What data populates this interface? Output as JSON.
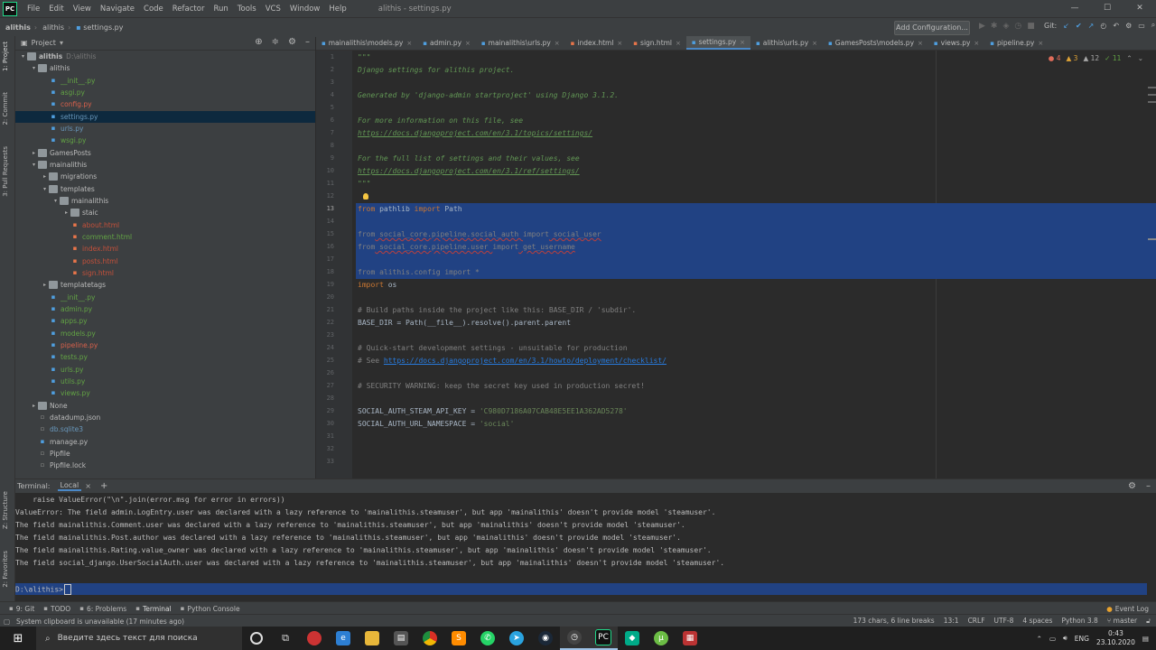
{
  "app": {
    "logo": "PC",
    "window_title": "alithis - settings.py"
  },
  "menu": [
    "File",
    "Edit",
    "View",
    "Navigate",
    "Code",
    "Refactor",
    "Run",
    "Tools",
    "VCS",
    "Window",
    "Help"
  ],
  "window_controls": [
    "—",
    "☐",
    "✕"
  ],
  "breadcrumb": [
    "alithis",
    "alithis",
    "settings.py"
  ],
  "toolbar": {
    "add_config": "Add Configuration...",
    "git_label": "Git:"
  },
  "left_stripe": [
    "1: Project",
    "2: Commit",
    "3: Pull Requests"
  ],
  "left_stripe_bottom": [
    "Z: Structure",
    "2: Favorites"
  ],
  "project_panel": {
    "title": "Project",
    "tree": [
      {
        "name": "alithis",
        "tail": "D:\\alithis",
        "type": "folder",
        "depth": 0,
        "open": true,
        "cls": "",
        "bold": true
      },
      {
        "name": "alithis",
        "type": "folder",
        "depth": 1,
        "open": true,
        "cls": ""
      },
      {
        "name": "__init__.py",
        "type": "py",
        "depth": 2,
        "cls": "py"
      },
      {
        "name": "asgi.py",
        "type": "py",
        "depth": 2,
        "cls": "py"
      },
      {
        "name": "config.py",
        "type": "py",
        "depth": 2,
        "cls": "err"
      },
      {
        "name": "settings.py",
        "type": "py",
        "depth": 2,
        "cls": "mod",
        "selected": true
      },
      {
        "name": "urls.py",
        "type": "py",
        "depth": 2,
        "cls": "mod"
      },
      {
        "name": "wsgi.py",
        "type": "py",
        "depth": 2,
        "cls": "py"
      },
      {
        "name": "GamesPosts",
        "type": "folder",
        "depth": 1,
        "open": false,
        "cls": ""
      },
      {
        "name": "mainalithis",
        "type": "folder",
        "depth": 1,
        "open": true,
        "cls": ""
      },
      {
        "name": "migrations",
        "type": "folder",
        "depth": 2,
        "open": false,
        "cls": ""
      },
      {
        "name": "templates",
        "type": "folder",
        "depth": 2,
        "open": true,
        "cls": ""
      },
      {
        "name": "mainalithis",
        "type": "folder",
        "depth": 3,
        "open": true,
        "cls": ""
      },
      {
        "name": "staic",
        "type": "folder",
        "depth": 4,
        "open": false,
        "cls": ""
      },
      {
        "name": "about.html",
        "type": "html",
        "depth": 4,
        "cls": "html"
      },
      {
        "name": "comment.html",
        "type": "html",
        "depth": 4,
        "cls": "hgreen"
      },
      {
        "name": "index.html",
        "type": "html",
        "depth": 4,
        "cls": "html"
      },
      {
        "name": "posts.html",
        "type": "html",
        "depth": 4,
        "cls": "html"
      },
      {
        "name": "sign.html",
        "type": "html",
        "depth": 4,
        "cls": "html"
      },
      {
        "name": "templatetags",
        "type": "folder",
        "depth": 2,
        "open": false,
        "cls": ""
      },
      {
        "name": "__init__.py",
        "type": "py",
        "depth": 2,
        "cls": "py"
      },
      {
        "name": "admin.py",
        "type": "py",
        "depth": 2,
        "cls": "py"
      },
      {
        "name": "apps.py",
        "type": "py",
        "depth": 2,
        "cls": "py"
      },
      {
        "name": "models.py",
        "type": "py",
        "depth": 2,
        "cls": "py"
      },
      {
        "name": "pipeline.py",
        "type": "py",
        "depth": 2,
        "cls": "err"
      },
      {
        "name": "tests.py",
        "type": "py",
        "depth": 2,
        "cls": "py"
      },
      {
        "name": "urls.py",
        "type": "py",
        "depth": 2,
        "cls": "py"
      },
      {
        "name": "utils.py",
        "type": "py",
        "depth": 2,
        "cls": "py"
      },
      {
        "name": "views.py",
        "type": "py",
        "depth": 2,
        "cls": "py"
      },
      {
        "name": "None",
        "type": "folder",
        "depth": 1,
        "open": false,
        "cls": ""
      },
      {
        "name": "datadump.json",
        "type": "gen",
        "depth": 1,
        "cls": ""
      },
      {
        "name": "db.sqlite3",
        "type": "gen",
        "depth": 1,
        "cls": "mod"
      },
      {
        "name": "manage.py",
        "type": "py",
        "depth": 1,
        "cls": ""
      },
      {
        "name": "Pipfile",
        "type": "gen",
        "depth": 1,
        "cls": ""
      },
      {
        "name": "Pipfile.lock",
        "type": "gen",
        "depth": 1,
        "cls": ""
      }
    ]
  },
  "editor_tabs": [
    {
      "label": "mainalithis\\models.py",
      "type": "py"
    },
    {
      "label": "admin.py",
      "type": "py"
    },
    {
      "label": "mainalithis\\urls.py",
      "type": "py"
    },
    {
      "label": "index.html",
      "type": "html"
    },
    {
      "label": "sign.html",
      "type": "html"
    },
    {
      "label": "settings.py",
      "type": "py",
      "active": true
    },
    {
      "label": "alithis\\urls.py",
      "type": "py"
    },
    {
      "label": "GamesPosts\\models.py",
      "type": "py"
    },
    {
      "label": "views.py",
      "type": "py"
    },
    {
      "label": "pipeline.py",
      "type": "py"
    }
  ],
  "inspections": {
    "errors": "4",
    "warnings": "3",
    "weak": "12",
    "ok": "11"
  },
  "editor": {
    "line_numbers": [
      "1",
      "2",
      "3",
      "4",
      "5",
      "6",
      "7",
      "8",
      "9",
      "10",
      "11",
      "12",
      "13",
      "14",
      "15",
      "16",
      "17",
      "18",
      "19",
      "20",
      "21",
      "22",
      "23",
      "24",
      "25",
      "26",
      "27",
      "28",
      "29",
      "30",
      "31",
      "32",
      "33"
    ],
    "current_line": 13,
    "l1": "\"\"\"",
    "l2": "Django settings for alithis project.",
    "l4": "Generated by 'django-admin startproject' using Django 3.1.2.",
    "l6": "For more information on this file, see",
    "l7": "https://docs.djangoproject.com/en/3.1/topics/settings/",
    "l9": "For the full list of settings and their values, see",
    "l10": "https://docs.djangoproject.com/en/3.1/ref/settings/",
    "l11": "\"\"\"",
    "l13": {
      "kw1": "from",
      "mod": " pathlib ",
      "kw2": "import",
      "name": " Path"
    },
    "l15": {
      "kw1": "from",
      "mod": " social_core.pipeline.social_auth ",
      "kw2": "import",
      "name": " social_user"
    },
    "l16": {
      "kw1": "from",
      "mod": " social_core.pipeline.user ",
      "kw2": "import",
      "name": " get_username"
    },
    "l18": {
      "kw1": "from",
      "mod": " alithis.config ",
      "kw2": "import",
      "name": " *"
    },
    "l19": {
      "kw": "import",
      "name": " os"
    },
    "l21": "# Build paths inside the project like this: BASE_DIR / 'subdir'.",
    "l22": "BASE_DIR = Path(__file__).resolve().parent.parent",
    "l24": "# Quick-start development settings - unsuitable for production",
    "l25a": "# See ",
    "l25b": "https://docs.djangoproject.com/en/3.1/howto/deployment/checklist/",
    "l27": "# SECURITY WARNING: keep the secret key used in production secret!",
    "l29a": "SOCIAL_AUTH_STEAM_API_KEY = ",
    "l29b": "'C980D7186A07CAB48E5EE1A362AD5278'",
    "l30a": "SOCIAL_AUTH_URL_NAMESPACE = ",
    "l30b": "'social'"
  },
  "terminal": {
    "label": "Terminal:",
    "tab": "Local",
    "lines": [
      "    raise ValueError(\"\\n\".join(error.msg for error in errors))",
      "ValueError: The field admin.LogEntry.user was declared with a lazy reference to 'mainalithis.steamuser', but app 'mainalithis' doesn't provide model 'steamuser'.",
      "The field mainalithis.Comment.user was declared with a lazy reference to 'mainalithis.steamuser', but app 'mainalithis' doesn't provide model 'steamuser'.",
      "The field mainalithis.Post.author was declared with a lazy reference to 'mainalithis.steamuser', but app 'mainalithis' doesn't provide model 'steamuser'.",
      "The field mainalithis.Rating.value_owner was declared with a lazy reference to 'mainalithis.steamuser', but app 'mainalithis' doesn't provide model 'steamuser'.",
      "The field social_django.UserSocialAuth.user was declared with a lazy reference to 'mainalithis.steamuser', but app 'mainalithis' doesn't provide model 'steamuser'."
    ],
    "prompt": "D:\\alithis>"
  },
  "bottom_tabs": [
    {
      "label": "9: Git",
      "icon": "git-icon"
    },
    {
      "label": "TODO",
      "icon": "todo-icon"
    },
    {
      "label": "6: Problems",
      "icon": "problems-icon"
    },
    {
      "label": "Terminal",
      "icon": "terminal-icon",
      "active": true
    },
    {
      "label": "Python Console",
      "icon": "python-icon"
    }
  ],
  "event_log": "Event Log",
  "status": {
    "message": "System clipboard is unavailable (17 minutes ago)",
    "chars": "173 chars, 6 line breaks",
    "pos": "13:1",
    "crlf": "CRLF",
    "enc": "UTF-8",
    "indent": "4 spaces",
    "python": "Python 3.8",
    "branch": "master"
  },
  "taskbar": {
    "search_placeholder": "Введите здесь текст для поиска",
    "lang": "ENG",
    "time": "0:43",
    "date": "23.10.2020"
  },
  "colors": {
    "accent": "#214283",
    "ide_bg": "#2b2b2b",
    "panel_bg": "#3c3f41"
  }
}
